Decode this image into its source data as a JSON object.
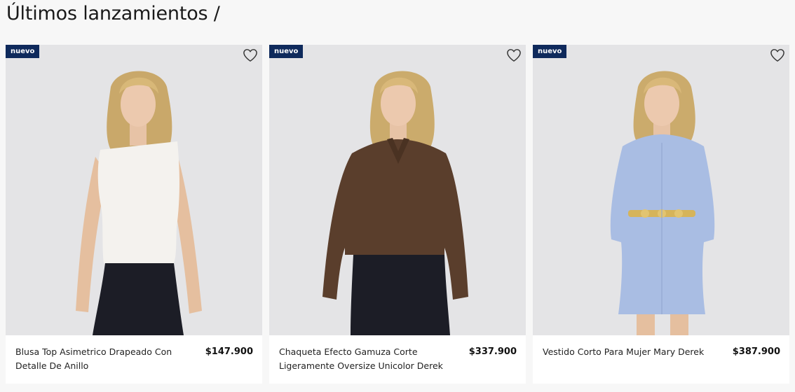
{
  "section": {
    "title": "Últimos lanzamientos /"
  },
  "products": [
    {
      "badge": "nuevo",
      "name": "Blusa Top Asimetrico Drapeado Con Detalle De Anillo",
      "price": "$147.900",
      "favorite_icon": "heart-outline-icon",
      "garment_color": "#f4f2ee",
      "bottom_color": "#1c1d26"
    },
    {
      "badge": "nuevo",
      "name": "Chaqueta Efecto Gamuza Corte Ligeramente Oversize Unicolor Derek",
      "price": "$337.900",
      "favorite_icon": "heart-outline-icon",
      "garment_color": "#5a3e2c",
      "bottom_color": "#1c1d26"
    },
    {
      "badge": "nuevo",
      "name": "Vestido Corto Para Mujer Mary Derek",
      "price": "$387.900",
      "favorite_icon": "heart-outline-icon",
      "garment_color": "#a9bde3",
      "bottom_color": "#a9bde3"
    }
  ]
}
